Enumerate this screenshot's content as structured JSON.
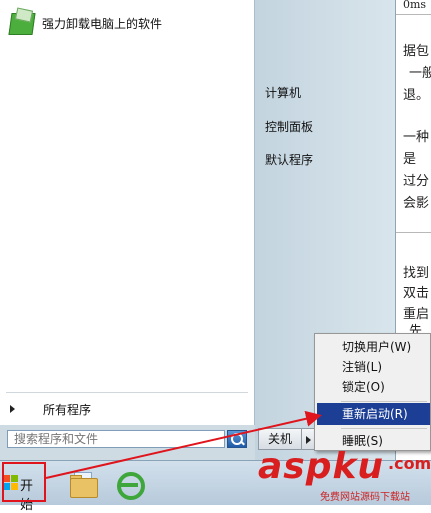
{
  "start_menu": {
    "pinned_program": "强力卸载电脑上的软件",
    "all_programs": "所有程序",
    "search_placeholder": "搜索程序和文件",
    "right_items": [
      "计算机",
      "控制面板",
      "默认程序"
    ],
    "shutdown_label": "关机"
  },
  "power_submenu": {
    "items": [
      "切换用户(W)",
      "注销(L)",
      "锁定(O)",
      "重新启动(R)",
      "睡眠(S)"
    ],
    "highlighted_index": 3
  },
  "taskbar": {
    "start_label": "开始",
    "pinned": [
      "windows-explorer",
      "internet-explorer"
    ]
  },
  "background_document": {
    "fragments": [
      "0ms",
      "据包",
      "一般",
      "退。",
      "一种",
      "是",
      "过分",
      "会影",
      "找到",
      "双击",
      "重启",
      "先"
    ]
  },
  "watermark": {
    "brand": "aspku",
    "tld": ".com",
    "tagline": "免费网站源码下载站"
  },
  "colors": {
    "highlight": "#1c3f95",
    "annotation_red": "#e0141c",
    "watermark_red": "#d81e1e"
  }
}
